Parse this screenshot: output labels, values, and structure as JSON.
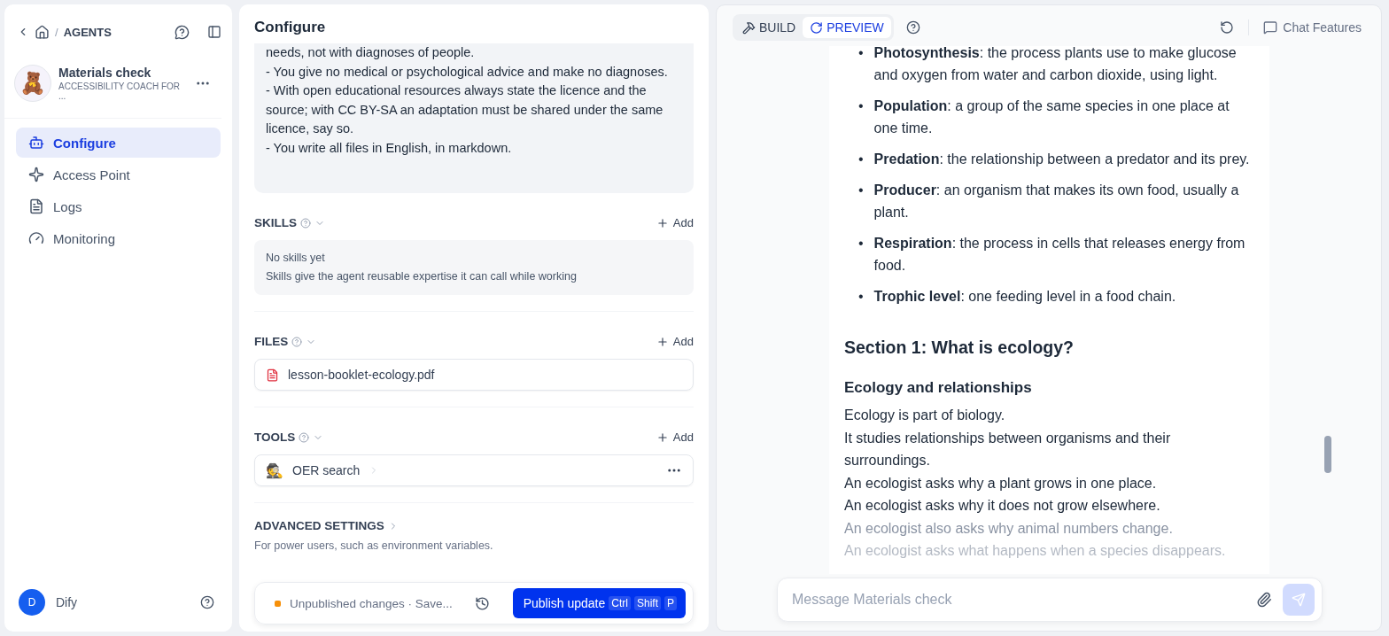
{
  "sidebar": {
    "separator": "/",
    "breadcrumb": "AGENTS",
    "agent": {
      "avatar": "🧸",
      "name": "Materials check",
      "subtitle": "ACCESSIBILITY COACH FOR ..."
    },
    "items": [
      {
        "label": "Configure",
        "kind": "configure",
        "selected": true
      },
      {
        "label": "Access Point",
        "kind": "access",
        "selected": false
      },
      {
        "label": "Logs",
        "kind": "logs",
        "selected": false
      },
      {
        "label": "Monitoring",
        "kind": "monitoring",
        "selected": false
      }
    ],
    "user": {
      "initial": "D",
      "name": "Dify"
    }
  },
  "configure": {
    "title": "Configure",
    "instructions": [
      "needs, not with diagnoses of people.",
      "- You give no medical or psychological advice and make no diagnoses.",
      "- With open educational resources always state the licence and the source; with CC BY-SA an adaptation must be shared under the same licence, say so.",
      "- You write all files in English, in markdown."
    ],
    "skills": {
      "title": "SKILLS",
      "add": "Add",
      "empty_title": "No skills yet",
      "empty_text": "Skills give the agent reusable expertise it can call while working"
    },
    "files": {
      "title": "FILES",
      "add": "Add",
      "items": [
        "lesson-booklet-ecology.pdf"
      ]
    },
    "tools": {
      "title": "TOOLS",
      "add": "Add",
      "items": [
        {
          "icon": "🕵",
          "name": "OER search"
        }
      ]
    },
    "advanced": {
      "title": "ADVANCED SETTINGS",
      "text": "For power users, such as environment variables."
    },
    "publish": {
      "status": "Unpublished changes · Save...",
      "button": "Publish update",
      "keys": [
        "Ctrl",
        "Shift",
        "P"
      ]
    }
  },
  "preview": {
    "tabs": [
      {
        "label": "BUILD",
        "kind": "build",
        "selected": false
      },
      {
        "label": "PREVIEW",
        "kind": "preview",
        "selected": true
      }
    ],
    "chat_features": "Chat Features",
    "glossary": [
      {
        "marker": "•",
        "text": "**Photosynthesis**: the process plants use to make glucose and oxygen from water and carbon dioxide, using light."
      },
      {
        "marker": "•",
        "text": "**Population**: a group of the same species in one place at one time."
      },
      {
        "marker": "•",
        "text": "**Predation**: the relationship between a predator and its prey."
      },
      {
        "marker": "•",
        "text": "**Producer**: an organism that makes its own food, usually a plant."
      },
      {
        "marker": "•",
        "text": "**Respiration**: the process in cells that releases energy from food."
      },
      {
        "marker": "•",
        "text": "**Trophic level**: one feeding level in a food chain."
      }
    ],
    "section_title": "Section 1: What is ecology?",
    "subheading": "Ecology and relationships",
    "paragraphs": [
      "Ecology is part of biology.",
      "It studies relationships between organisms and their surroundings.",
      "An ecologist asks why a plant grows in one place.",
      "An ecologist asks why it does not grow elsewhere.",
      "An ecologist also asks why animal numbers change.",
      "An ecologist asks what happens when a species disappears."
    ],
    "message_placeholder": "Message Materials check"
  }
}
